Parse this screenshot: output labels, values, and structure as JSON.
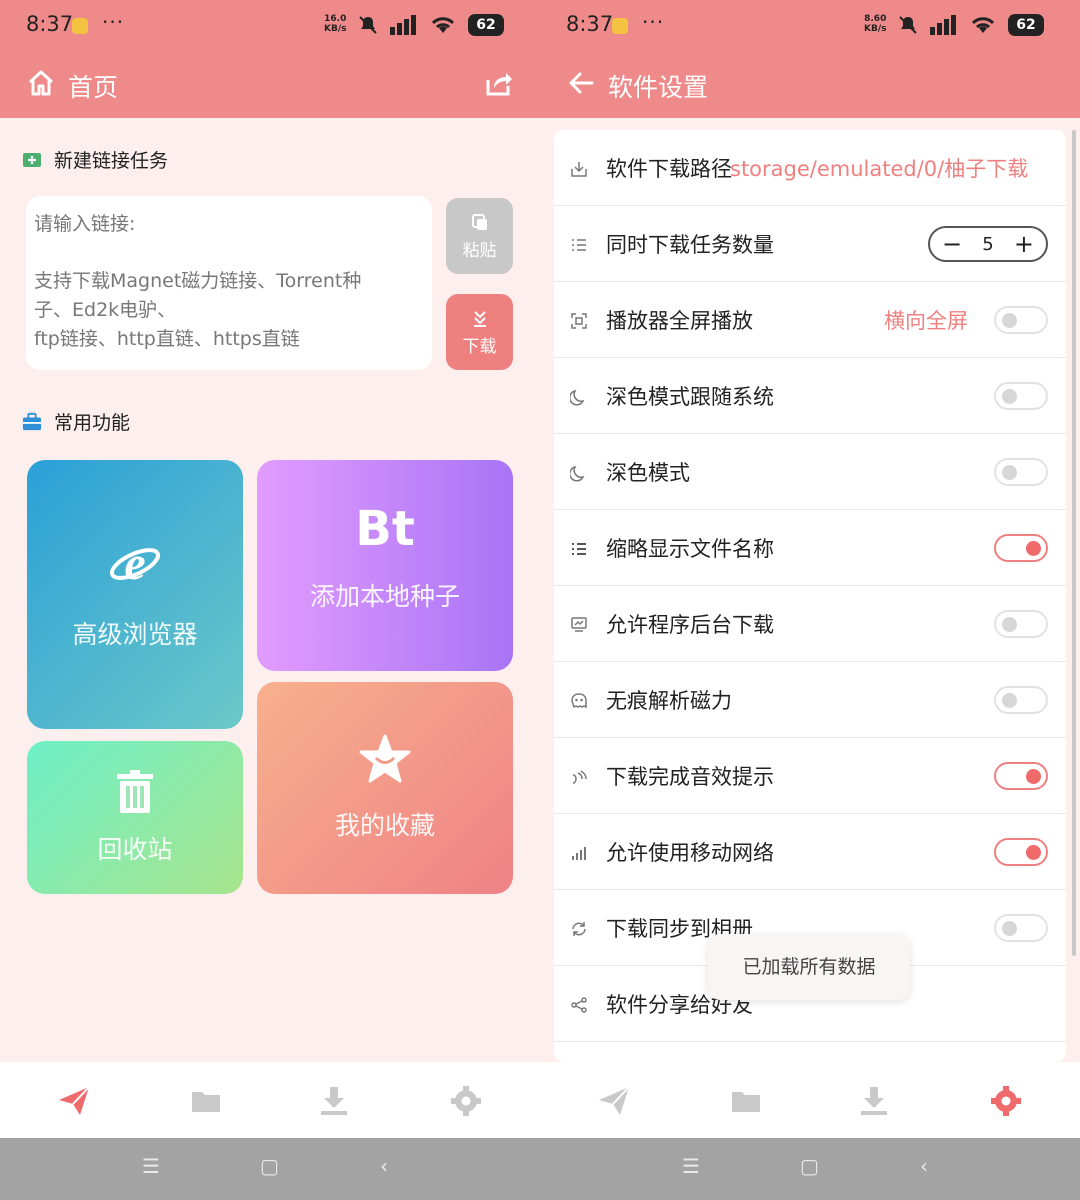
{
  "left": {
    "status": {
      "time": "8:37",
      "dots": "···",
      "speed_top": "16.0",
      "speed_bottom": "KB/s",
      "battery": "62"
    },
    "appbar": {
      "title": "首页"
    },
    "new_task": {
      "heading": "新建链接任务",
      "placeholder_line1": "请输入链接:",
      "placeholder_line2": "支持下载Magnet磁力链接、Torrent种",
      "placeholder_line3": "子、Ed2k电驴、",
      "placeholder_line4": "ftp链接、http直链、https直链",
      "paste_label": "粘贴",
      "download_label": "下载"
    },
    "functions": {
      "heading": "常用功能",
      "browser_label": "高级浏览器",
      "bt_glyph": "Bt",
      "bt_label": "添加本地种子",
      "recycle_label": "回收站",
      "favorites_label": "我的收藏"
    }
  },
  "right": {
    "status": {
      "time": "8:37",
      "dots": "···",
      "speed_top": "8.60",
      "speed_bottom": "KB/s",
      "battery": "62"
    },
    "appbar": {
      "title": "软件设置"
    },
    "settings": {
      "download_path_label": "软件下载路径",
      "download_path_value": "storage/emulated/0/柚子下载",
      "concurrent_label": "同时下载任务数量",
      "concurrent_value": "5",
      "stepper_minus": "−",
      "stepper_plus": "+",
      "fullscreen_label": "播放器全屏播放",
      "fullscreen_value": "横向全屏",
      "fullscreen_on": false,
      "dark_follow_label": "深色模式跟随系统",
      "dark_follow_on": false,
      "dark_mode_label": "深色模式",
      "dark_mode_on": false,
      "thumb_name_label": "缩略显示文件名称",
      "thumb_name_on": true,
      "background_label": "允许程序后台下载",
      "background_on": false,
      "incognito_label": "无痕解析磁力",
      "incognito_on": false,
      "sound_label": "下载完成音效提示",
      "sound_on": true,
      "mobile_label": "允许使用移动网络",
      "mobile_on": true,
      "album_label": "下载同步到相册",
      "album_on": false,
      "share_label": "软件分享给好友"
    },
    "toast": "已加载所有数据"
  },
  "colors": {
    "accent": "#ef8a8a",
    "toggle_on": "#ef6a6a",
    "value_text": "#ef8080"
  },
  "sysnav": {
    "menu": "☰",
    "home": "▢",
    "back": "‹"
  }
}
